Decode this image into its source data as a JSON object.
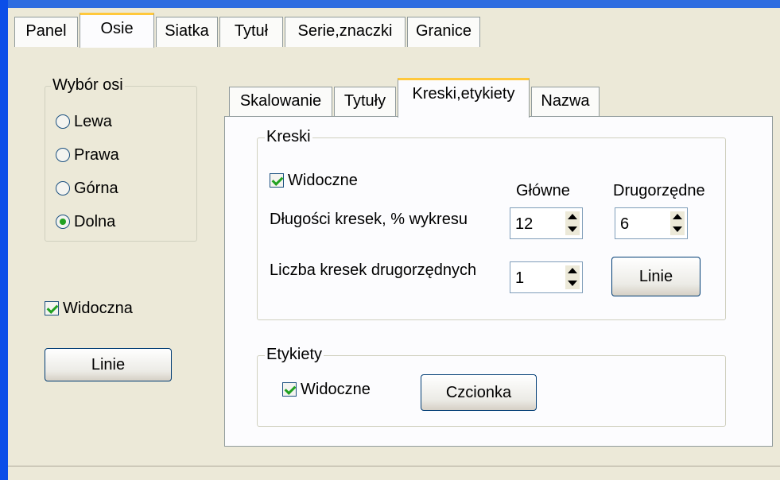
{
  "outer_tabs": [
    "Panel",
    "Osie",
    "Siatka",
    "Tytuł",
    "Serie,znaczki",
    "Granice"
  ],
  "axis_choice": {
    "title": "Wybór osi",
    "options": [
      "Lewa",
      "Prawa",
      "Górna",
      "Dolna"
    ],
    "selected": "Dolna"
  },
  "visible_checkbox": {
    "label": "Widoczna",
    "checked": true
  },
  "lines_button": "Linie",
  "inner_tabs": [
    "Skalowanie",
    "Tytuły",
    "Kreski,etykiety",
    "Nazwa"
  ],
  "kreski": {
    "title": "Kreski",
    "visible": {
      "label": "Widoczne",
      "checked": true
    },
    "col_major": "Główne",
    "col_minor": "Drugorzędne",
    "length_label": "Długości kresek, % wykresu",
    "major_length": "12",
    "minor_length": "6",
    "minor_count_label": "Liczba kresek drugorzędnych",
    "minor_count": "1",
    "lines_button": "Linie"
  },
  "etykiety": {
    "title": "Etykiety",
    "visible": {
      "label": "Widoczne",
      "checked": true
    },
    "font_button": "Czcionka"
  },
  "colors": {
    "accent_tab": "#FFC83C",
    "check": "#21A121",
    "window_bg": "#ECE9D8",
    "title_blue": "#0B4EE8"
  }
}
